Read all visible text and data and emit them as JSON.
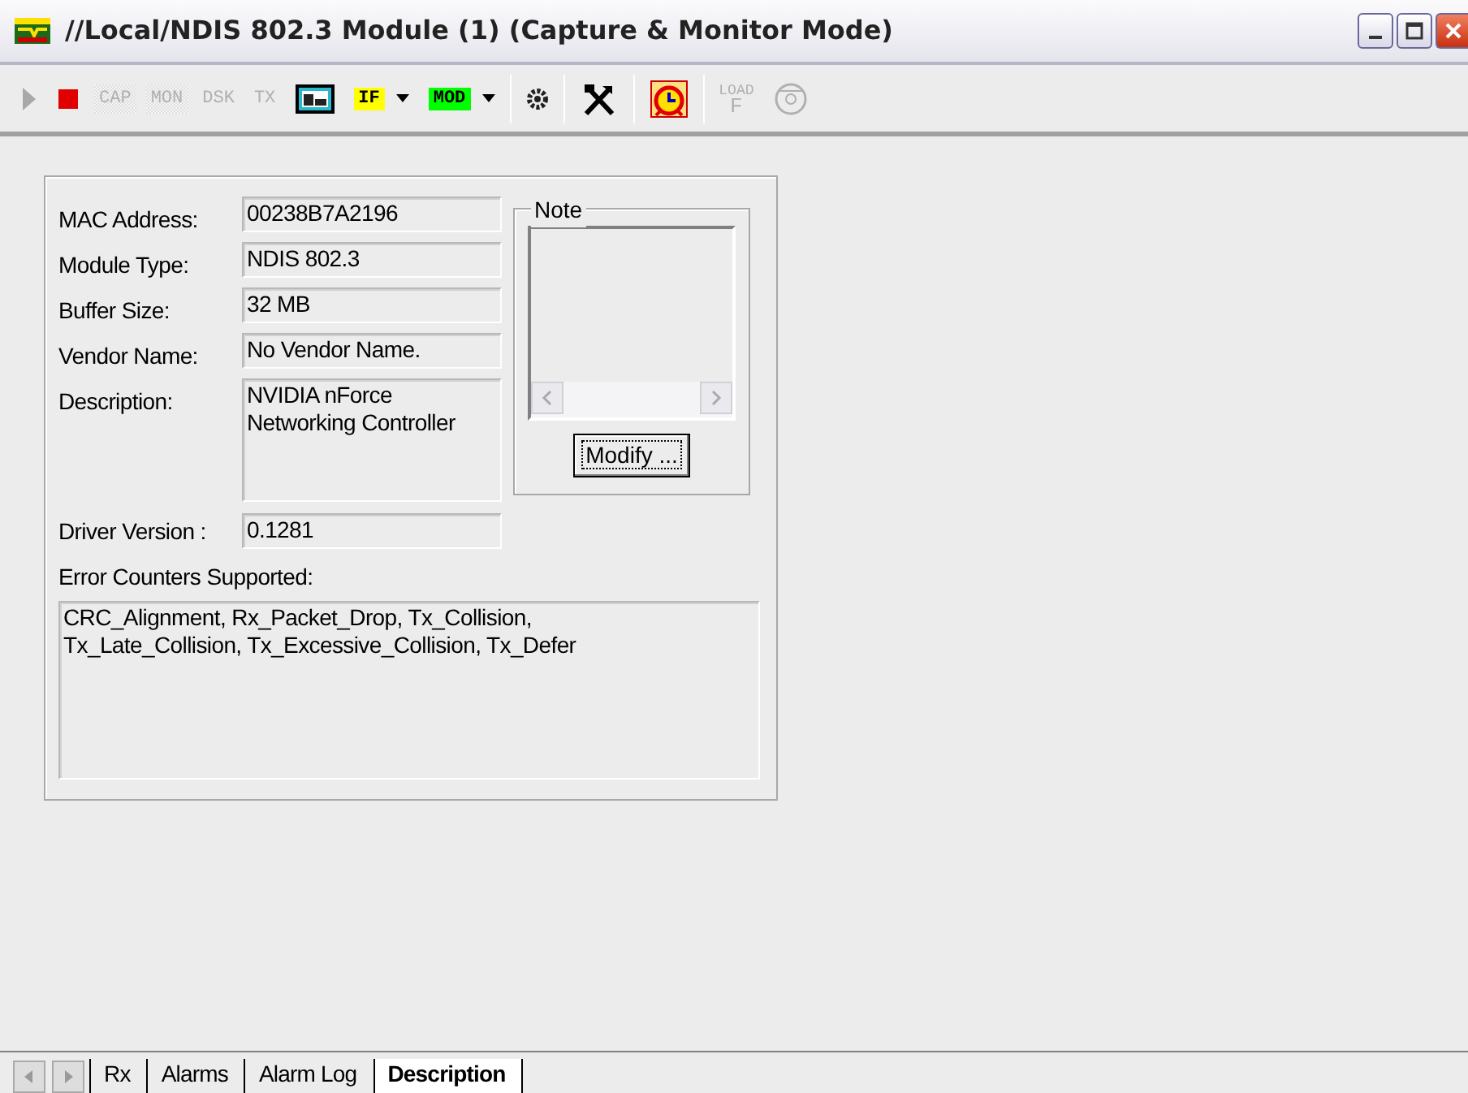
{
  "window": {
    "title": "//Local/NDIS 802.3 Module (1) (Capture & Monitor Mode)"
  },
  "toolbar": [
    {
      "kind": "play",
      "disabled": true
    },
    {
      "kind": "stop",
      "disabled": false
    },
    {
      "kind": "label",
      "text": "CAP",
      "disabled": true,
      "pressed": true
    },
    {
      "kind": "label",
      "text": "MON",
      "disabled": true,
      "pressed": true
    },
    {
      "kind": "label",
      "text": "DSK",
      "disabled": true,
      "pressed": false
    },
    {
      "kind": "label",
      "text": "TX",
      "disabled": true,
      "pressed": false
    },
    {
      "kind": "monitor"
    },
    {
      "kind": "dropdown",
      "text": "IF",
      "color": "#ffff00"
    },
    {
      "kind": "dropdown",
      "text": "MOD",
      "color": "#00ff00"
    },
    {
      "kind": "separator"
    },
    {
      "kind": "gear"
    },
    {
      "kind": "separator"
    },
    {
      "kind": "tools"
    },
    {
      "kind": "separator"
    },
    {
      "kind": "alarm"
    },
    {
      "kind": "separator"
    },
    {
      "kind": "load",
      "text": "LOAD",
      "subtext": "F",
      "disabled": true
    },
    {
      "kind": "disk",
      "disabled": true
    }
  ],
  "fields": [
    {
      "label": "MAC Address:",
      "value": "00238B7A2196"
    },
    {
      "label": "Module Type:",
      "value": "NDIS 802.3"
    },
    {
      "label": "Buffer Size:",
      "value": "32 MB"
    },
    {
      "label": "Vendor Name:",
      "value": "No Vendor Name."
    },
    {
      "label": "Description:",
      "value": "NVIDIA nForce\nNetworking Controller",
      "multiline": true
    }
  ],
  "note": {
    "title": "Note",
    "button": "Modify ..."
  },
  "driver": {
    "label": "Driver Version :",
    "value": "0.1281"
  },
  "error_counters": {
    "label": "Error Counters Supported:",
    "value": "CRC_Alignment,  Rx_Packet_Drop,  Tx_Collision,\nTx_Late_Collision,  Tx_Excessive_Collision,  Tx_Defer"
  },
  "tabs": [
    {
      "label": "Rx",
      "selected": false
    },
    {
      "label": "Alarms",
      "selected": false
    },
    {
      "label": "Alarm Log",
      "selected": false
    },
    {
      "label": "Description",
      "selected": true
    }
  ]
}
